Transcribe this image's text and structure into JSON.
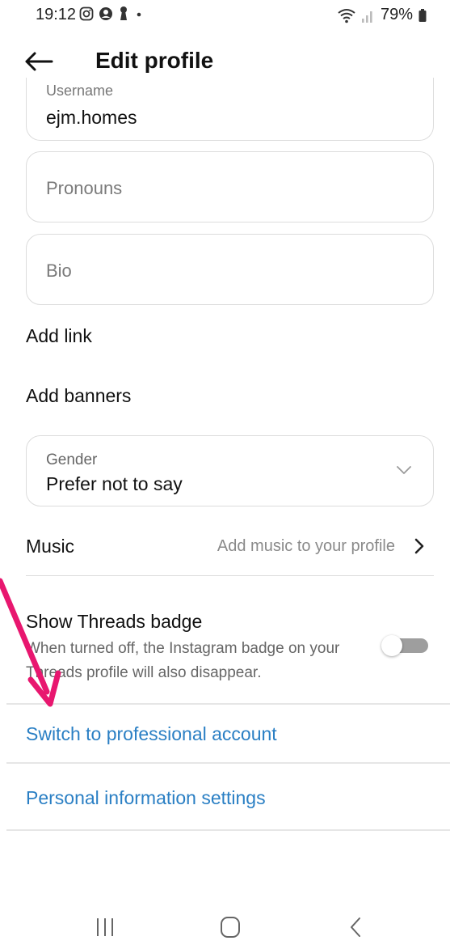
{
  "status_bar": {
    "time": "19:12",
    "battery": "79%",
    "icons": [
      "instagram-icon",
      "account-icon",
      "keyhole-icon",
      "dot-icon",
      "wifi-icon",
      "signal-icon",
      "battery-icon"
    ]
  },
  "header": {
    "title": "Edit profile",
    "back_icon": "back-arrow-icon"
  },
  "form": {
    "username": {
      "label": "Username",
      "value": "ejm.homes"
    },
    "pronouns": {
      "placeholder": "Pronouns"
    },
    "bio": {
      "placeholder": "Bio"
    },
    "add_link": "Add link",
    "add_banners": "Add banners",
    "gender": {
      "label": "Gender",
      "value": "Prefer not to say"
    },
    "music": {
      "label": "Music",
      "hint": "Add music to your profile"
    },
    "threads_badge": {
      "title": "Show Threads badge",
      "description": "When turned off, the Instagram badge on your Threads profile will also disappear.",
      "enabled": false
    }
  },
  "links": {
    "switch_professional": "Switch to professional account",
    "personal_info": "Personal information settings"
  },
  "colors": {
    "link_blue": "#2a7fc4",
    "annotation_arrow": "#e8176f",
    "toggle_off": "#9e9e9e"
  },
  "nav": {
    "icons": [
      "recent-apps-icon",
      "home-icon",
      "back-icon"
    ]
  }
}
